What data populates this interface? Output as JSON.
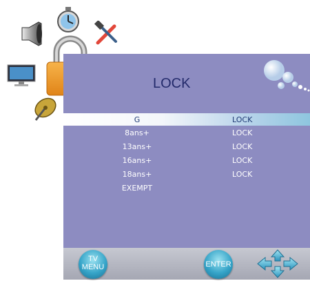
{
  "menu": {
    "title": "LOCK",
    "columns_note": "",
    "rows": [
      {
        "name": "G",
        "value": "LOCK",
        "selected": true
      },
      {
        "name": "8ans+",
        "value": "LOCK",
        "selected": false
      },
      {
        "name": "13ans+",
        "value": "LOCK",
        "selected": false
      },
      {
        "name": "16ans+",
        "value": "LOCK",
        "selected": false
      },
      {
        "name": "18ans+",
        "value": "LOCK",
        "selected": false
      },
      {
        "name": "EXEMPT",
        "value": "",
        "selected": false
      }
    ]
  },
  "footer": {
    "tv_menu_label_line1": "TV",
    "tv_menu_label_line2": "MENU",
    "enter_label": "ENTER"
  },
  "icons": [
    "speaker-icon",
    "stopwatch-icon",
    "tools-icon",
    "monitor-icon",
    "lock-icon",
    "satellite-dish-icon",
    "bubbles-icon",
    "arrow-keys-icon"
  ],
  "colors": {
    "panel": "#8d8cc1",
    "title": "#232a6b",
    "highlight": "#b7d3ea"
  }
}
